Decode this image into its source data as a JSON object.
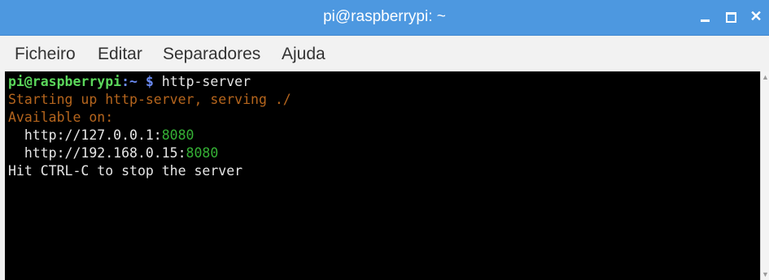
{
  "window": {
    "title": "pi@raspberrypi: ~"
  },
  "menu": {
    "items": [
      "Ficheiro",
      "Editar",
      "Separadores",
      "Ajuda"
    ]
  },
  "terminal": {
    "prompt_user": "pi@raspberrypi",
    "prompt_path": ":~ $",
    "command": " http-server",
    "line1": "Starting up http-server, serving ./",
    "line2": "Available on:",
    "url1_host": "  http://127.0.0.1:",
    "url1_port": "8080",
    "url2_host": "  http://192.168.0.15:",
    "url2_port": "8080",
    "line5": "Hit CTRL-C to stop the server"
  },
  "colors": {
    "titlebar": "#4d98e0",
    "terminal_bg": "#000000",
    "prompt_user": "#5bd75b",
    "prompt_path": "#6c8cf5",
    "info_text": "#b5651d",
    "port": "#35b235"
  },
  "icons": {
    "minimize": "minimize-icon",
    "maximize": "maximize-icon",
    "close": "close-icon"
  }
}
